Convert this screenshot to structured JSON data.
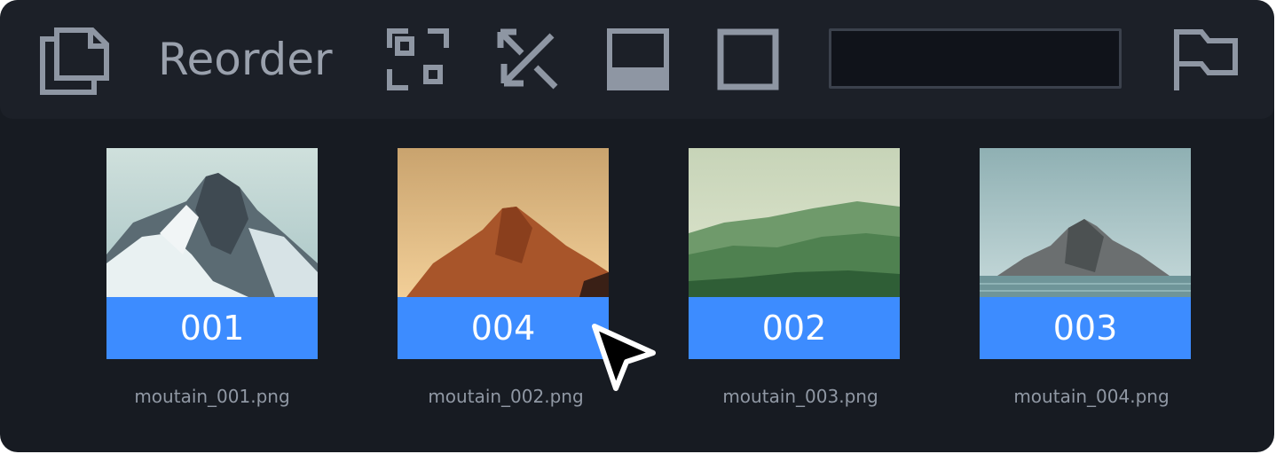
{
  "toolbar": {
    "reorder_label": "Reorder",
    "field_value": "",
    "icons": [
      "copy-pages-icon",
      "grid-layout-icon",
      "expand-arrows-icon",
      "filled-frame-icon",
      "empty-frame-icon",
      "flag-icon"
    ]
  },
  "cards": [
    {
      "badge": "001",
      "filename": "moutain_001.png",
      "image": "snowy-mountain"
    },
    {
      "badge": "004",
      "filename": "moutain_002.png",
      "image": "orange-desert-mountain"
    },
    {
      "badge": "002",
      "filename": "moutain_003.png",
      "image": "green-forest-hills"
    },
    {
      "badge": "003",
      "filename": "moutain_004.png",
      "image": "rock-island-in-lake"
    }
  ],
  "colors": {
    "background": "#171b22",
    "toolbar": "#1c2028",
    "icon": "#8e96a3",
    "badge": "#3d8cff",
    "filename_text": "#9098a4"
  },
  "cursor": "arrow-cursor"
}
